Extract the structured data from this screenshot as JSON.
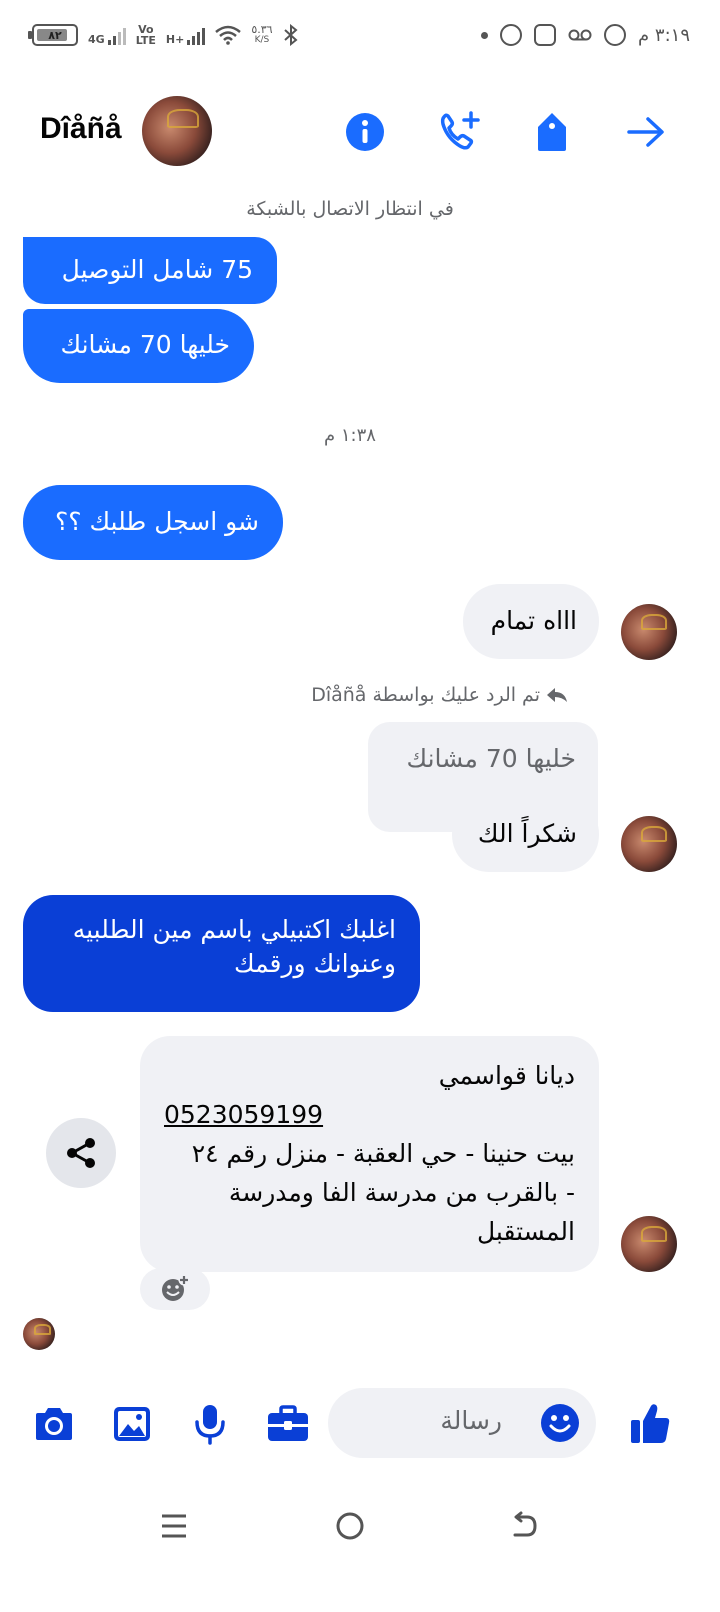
{
  "status_bar": {
    "battery_level": "٨٢",
    "network_4g": "4G",
    "volte": "Vo\nLTE",
    "network_hplus": "H+",
    "data_speed": "٥.٣٦",
    "data_unit": "K/S",
    "time": "٣:١٩ م"
  },
  "header": {
    "contact_name": "Dîåñå",
    "accent_color": "#1a6cff"
  },
  "chat": {
    "network_status": "في انتظار الاتصال بالشبكة",
    "timestamp": "١:٣٨ م",
    "reply_note": "تم الرد عليك بواسطة Dîåñå",
    "messages": {
      "m1": "75 شامل التوصيل",
      "m2": "خليها 70 مشانك",
      "m3": "شو اسجل طلبك ؟؟",
      "m4": "اااه تمام",
      "quoted": "خليها 70 مشانك",
      "m5": "شكراً الك",
      "m6_line1": "اغلبك اكتبيلي باسم مين الطلبيه",
      "m6_line2": "وعنوانك ورقمك",
      "m7_name": "ديانا قواسمي",
      "m7_phone": "0523059199",
      "m7_address_1": "بيت حنينا - حي العقبة - منزل رقم ٢٤",
      "m7_address_2": "- بالقرب من مدرسة الفا ومدرسة",
      "m7_address_3": "المستقبل"
    }
  },
  "composer": {
    "placeholder": "رسالة"
  },
  "icons": {
    "info": "info-icon",
    "call": "add-call-icon",
    "tag": "tag-icon",
    "forward": "arrow-right-icon",
    "camera": "camera-icon",
    "gallery": "image-icon",
    "mic": "microphone-icon",
    "toolbox": "briefcase-icon",
    "emoji": "emoji-icon",
    "like": "thumbs-up-icon",
    "share": "share-icon",
    "react": "add-reaction-icon"
  }
}
